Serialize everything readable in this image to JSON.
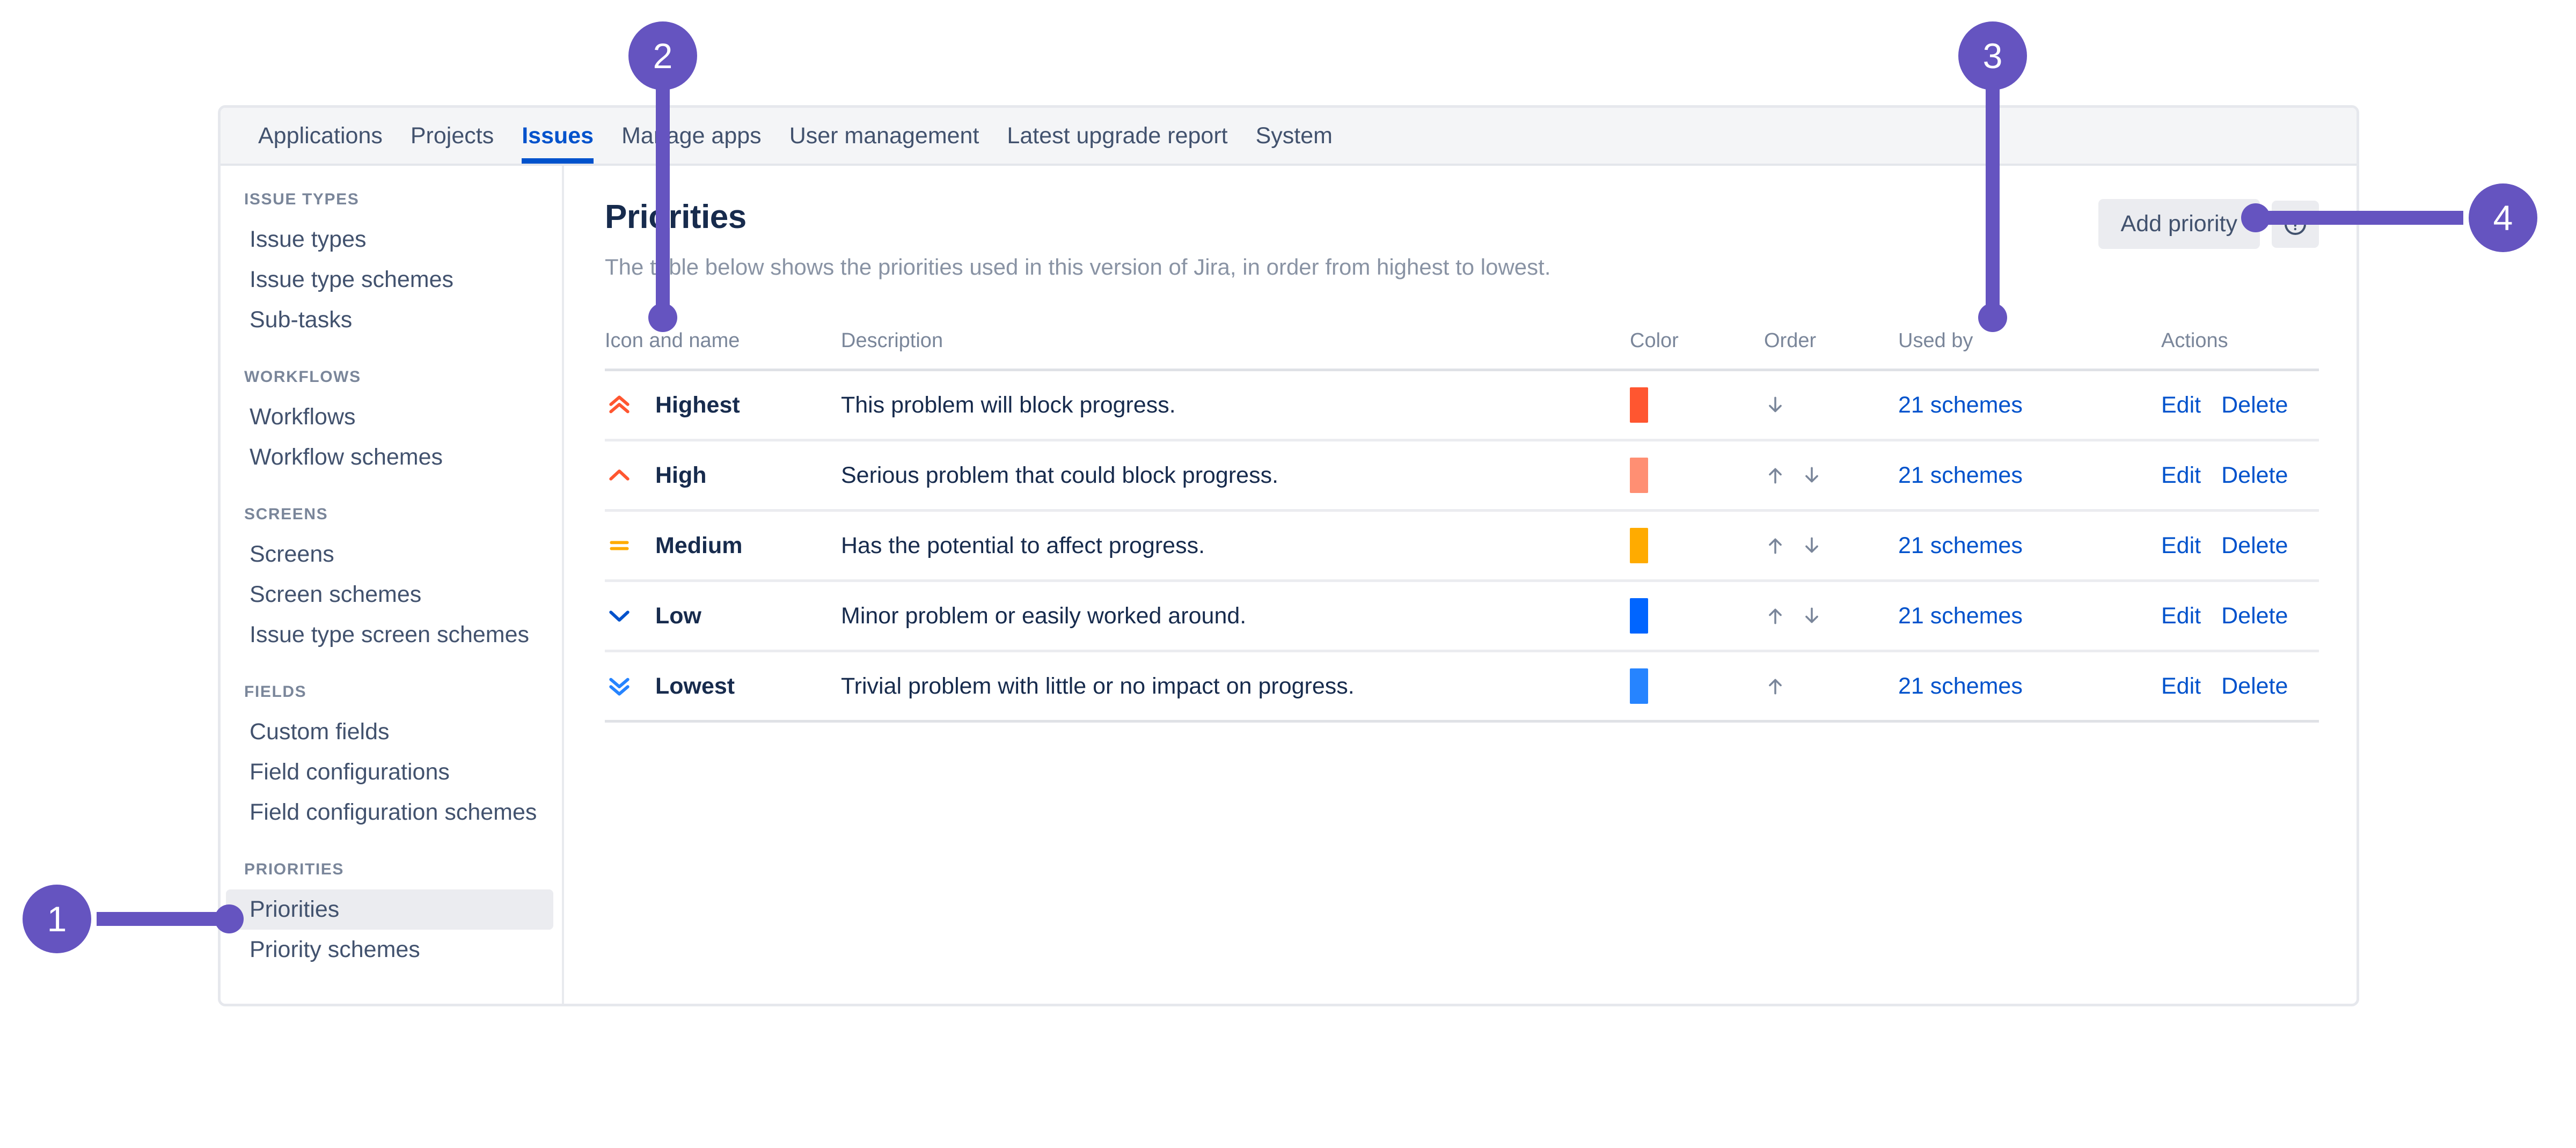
{
  "nav": {
    "tabs": [
      {
        "label": "Applications",
        "active": false
      },
      {
        "label": "Projects",
        "active": false
      },
      {
        "label": "Issues",
        "active": true
      },
      {
        "label": "Manage apps",
        "active": false
      },
      {
        "label": "User management",
        "active": false
      },
      {
        "label": "Latest upgrade report",
        "active": false
      },
      {
        "label": "System",
        "active": false
      }
    ]
  },
  "sidebar": {
    "groups": [
      {
        "title": "ISSUE TYPES",
        "items": [
          {
            "label": "Issue types",
            "selected": false
          },
          {
            "label": "Issue type schemes",
            "selected": false
          },
          {
            "label": "Sub-tasks",
            "selected": false
          }
        ]
      },
      {
        "title": "WORKFLOWS",
        "items": [
          {
            "label": "Workflows",
            "selected": false
          },
          {
            "label": "Workflow schemes",
            "selected": false
          }
        ]
      },
      {
        "title": "SCREENS",
        "items": [
          {
            "label": "Screens",
            "selected": false
          },
          {
            "label": "Screen schemes",
            "selected": false
          },
          {
            "label": "Issue type screen schemes",
            "selected": false
          }
        ]
      },
      {
        "title": "FIELDS",
        "items": [
          {
            "label": "Custom fields",
            "selected": false
          },
          {
            "label": "Field configurations",
            "selected": false
          },
          {
            "label": "Field configuration schemes",
            "selected": false
          }
        ]
      },
      {
        "title": "PRIORITIES",
        "items": [
          {
            "label": "Priorities",
            "selected": true
          },
          {
            "label": "Priority schemes",
            "selected": false
          }
        ]
      }
    ]
  },
  "main": {
    "title": "Priorities",
    "subtitle": "The table below shows the priorities used in this version of Jira, in order from highest to lowest.",
    "add_priority_label": "Add priority",
    "help_icon": "help-circle-icon"
  },
  "table": {
    "headers": {
      "icon_and_name": "Icon and name",
      "description": "Description",
      "color": "Color",
      "order": "Order",
      "used_by": "Used by",
      "actions": "Actions"
    },
    "rows": [
      {
        "name": "Highest",
        "icon": "double-chevron-up-icon",
        "icon_color": "#ff5630",
        "description": "This problem will block progress.",
        "color": "#ff5630",
        "order_up": false,
        "order_down": true,
        "used_by": "21 schemes",
        "edit_label": "Edit",
        "delete_label": "Delete"
      },
      {
        "name": "High",
        "icon": "chevron-up-icon",
        "icon_color": "#ff5630",
        "description": "Serious problem that could block progress.",
        "color": "#ff8f73",
        "order_up": true,
        "order_down": true,
        "used_by": "21 schemes",
        "edit_label": "Edit",
        "delete_label": "Delete"
      },
      {
        "name": "Medium",
        "icon": "equals-icon",
        "icon_color": "#ffab00",
        "description": "Has the potential to affect progress.",
        "color": "#ffab00",
        "order_up": true,
        "order_down": true,
        "used_by": "21 schemes",
        "edit_label": "Edit",
        "delete_label": "Delete"
      },
      {
        "name": "Low",
        "icon": "chevron-down-icon",
        "icon_color": "#0052cc",
        "description": "Minor problem or easily worked around.",
        "color": "#0065ff",
        "order_up": true,
        "order_down": true,
        "used_by": "21 schemes",
        "edit_label": "Edit",
        "delete_label": "Delete"
      },
      {
        "name": "Lowest",
        "icon": "double-chevron-down-icon",
        "icon_color": "#2684ff",
        "description": "Trivial problem with little or no impact on progress.",
        "color": "#2684ff",
        "order_up": true,
        "order_down": false,
        "used_by": "21 schemes",
        "edit_label": "Edit",
        "delete_label": "Delete"
      }
    ]
  },
  "annotations": {
    "accent_color": "#6554c0",
    "callouts": [
      {
        "number": "1",
        "target": "sidebar-item-priorities"
      },
      {
        "number": "2",
        "target": "table-header-icon-and-name"
      },
      {
        "number": "3",
        "target": "table-header-used-by"
      },
      {
        "number": "4",
        "target": "help-button"
      }
    ]
  }
}
